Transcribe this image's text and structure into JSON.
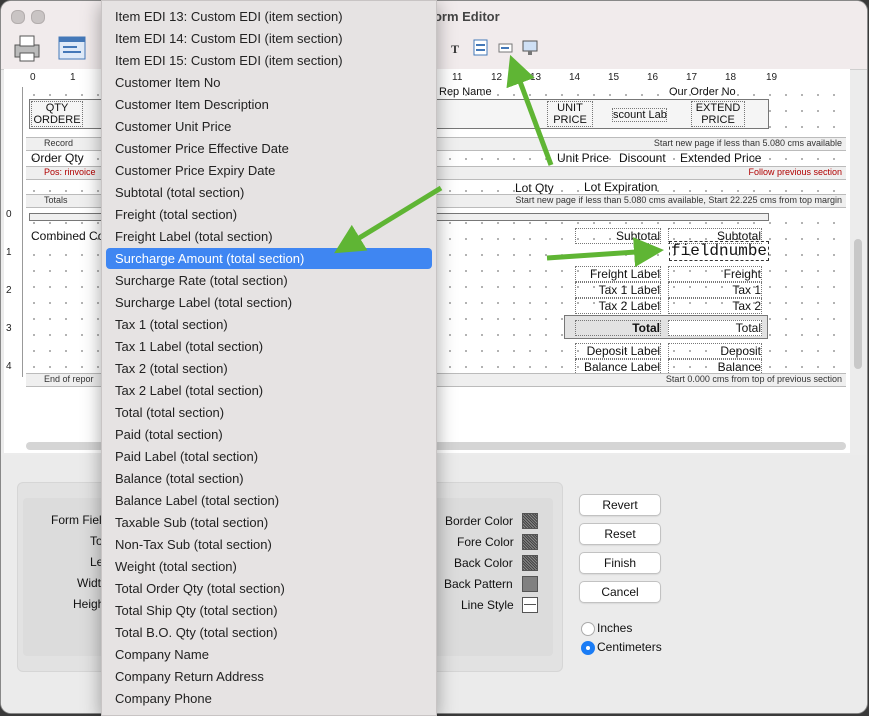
{
  "window": {
    "title": "Form Editor"
  },
  "ruler": {
    "h_numbers": [
      "0",
      "1",
      "11",
      "12",
      "13",
      "14",
      "15",
      "16",
      "17",
      "18",
      "19"
    ],
    "v_numbers": [
      "0",
      "1",
      "2",
      "3",
      "4"
    ]
  },
  "report": {
    "header_boxes": [
      "QTY ORDERE",
      "UNIT PRICE",
      "scount Lab",
      "EXTEND PRICE"
    ],
    "header_top_partial": [
      "Rep Name",
      "Our Order No"
    ],
    "band_record": "Record",
    "band_record_right": "Start new page if less than 5.080 cms available",
    "detail_fields": [
      "Order Qty",
      "Unit Price",
      "Discount",
      "Extended Price"
    ],
    "band_pos": "Pos: rinvoice",
    "band_pos_right": "Follow previous section",
    "lot_fields": [
      "Lot Qty",
      "Lot Expiration"
    ],
    "band_totals": "Totals",
    "band_totals_right": "Start new page if less than 5.080 cms available, Start 22.225 cms from top margin",
    "combined": "Combined Co",
    "labels": [
      "Subtotal",
      "Freight Label",
      "Tax 1 Label",
      "Tax 2 Label",
      "Total",
      "Deposit Label",
      "Balance Label"
    ],
    "values": [
      "Subtotal",
      "Freight",
      "Tax 1",
      "Tax 2",
      "Total",
      "Deposit",
      "Balance"
    ],
    "fieldnumber": "fieldnumbe",
    "band_end": "End of repor",
    "band_end_right": "Start 0.000 cms from top of previous section"
  },
  "properties": {
    "left_labels": [
      "Form Fiel",
      "To",
      "Le",
      "Widt",
      "Heigh"
    ],
    "color_labels": [
      "Border Color",
      "Fore Color",
      "Back Color",
      "Back Pattern",
      "Line Style"
    ]
  },
  "buttons": {
    "revert": "Revert",
    "reset": "Reset",
    "finish": "Finish",
    "cancel": "Cancel"
  },
  "units": {
    "inches": "Inches",
    "centimeters": "Centimeters",
    "selected": "Centimeters"
  },
  "menu": {
    "selected": "Surcharge Amount (total section)",
    "items": [
      "Item EDI 13: Custom EDI (item section)",
      "Item EDI 14: Custom EDI (item section)",
      "Item EDI 15: Custom EDI (item section)",
      "Customer Item No",
      "Customer Item Description",
      "Customer Unit Price",
      "Customer Price Effective Date",
      "Customer Price Expiry Date",
      "Subtotal (total section)",
      "Freight (total section)",
      "Freight Label (total section)",
      "Surcharge Amount (total section)",
      "Surcharge Rate (total section)",
      "Surcharge Label (total section)",
      "Tax 1 (total section)",
      "Tax 1 Label (total section)",
      "Tax 2 (total section)",
      "Tax 2 Label (total section)",
      "Total (total section)",
      "Paid (total section)",
      "Paid Label (total section)",
      "Balance (total section)",
      "Balance Label (total section)",
      "Taxable Sub (total section)",
      "Non-Tax Sub (total section)",
      "Weight (total section)",
      "Total Order Qty (total section)",
      "Total Ship Qty (total section)",
      "Total B.O. Qty (total section)",
      "Company Name",
      "Company Return Address",
      "Company Phone"
    ]
  },
  "colors": {
    "accent": "#3f86f2",
    "arrow": "#5fb534"
  }
}
